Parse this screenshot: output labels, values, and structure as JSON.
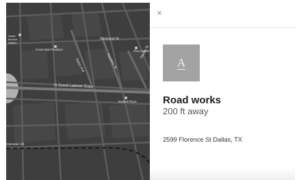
{
  "map": {
    "labels": {
      "cantegral": "Cantegral St",
      "fresh_market": "Fresh Mart Produce",
      "santa_monica": "Santa Monica Station",
      "good_latimer": "N Good Latimer Expy",
      "swiss": "Swiss Ave",
      "hawkins": "Hawkins St",
      "sevilla": "Sevilla St",
      "pine_house": "Pine House",
      "bottom_left": "Interstate Hill",
      "tower_plaza": "Bottled Plaza"
    }
  },
  "panel": {
    "close_glyph": "×",
    "thumbnail_letter": "A",
    "title": "Road works",
    "distance": "200 ft away",
    "address": "2599 Florence St Dallas, TX"
  }
}
